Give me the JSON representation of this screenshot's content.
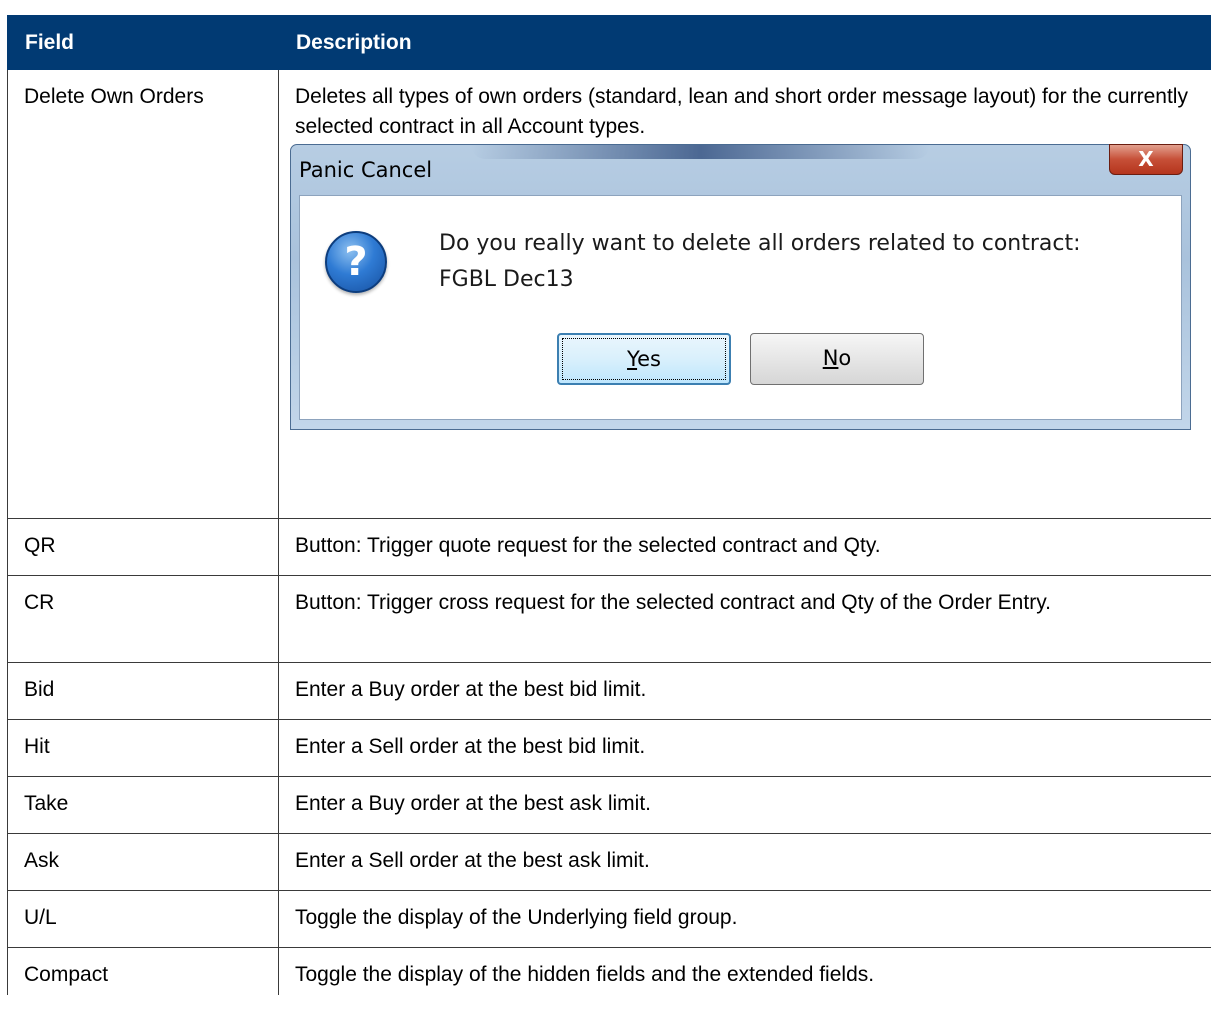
{
  "header": {
    "col1": "Field",
    "col2": "Description"
  },
  "first_row": {
    "field": "Delete Own Orders",
    "description": "Deletes all types of own orders (standard, lean and short order message layout) for the currently selected contract in all Account types."
  },
  "dialog": {
    "title": "Panic Cancel",
    "close_label": "X",
    "icon": "question-icon",
    "message_line1": "Do you really want to delete all orders related to contract:",
    "message_line2": "FGBL Dec13",
    "yes_underlined": "Y",
    "yes_rest": "es",
    "no_underlined": "N",
    "no_rest": "o"
  },
  "rows": [
    {
      "field": "QR",
      "description": "Button: Trigger quote request for the selected contract and Qty."
    },
    {
      "field": "CR",
      "description": "Button: Trigger cross request for the selected contract and Qty of the Order Entry."
    },
    {
      "field": "Bid",
      "description": "Enter a Buy order at the best bid limit."
    },
    {
      "field": "Hit",
      "description": "Enter a Sell order at the best bid limit."
    },
    {
      "field": "Take",
      "description": "Enter a Buy order at the best ask limit."
    },
    {
      "field": "Ask",
      "description": "Enter a Sell order at the best ask limit."
    },
    {
      "field": "U/L",
      "description": "Toggle the display of the Underlying field group."
    },
    {
      "field": "Compact",
      "description": "Toggle the display of the hidden fields and the extended fields."
    }
  ]
}
